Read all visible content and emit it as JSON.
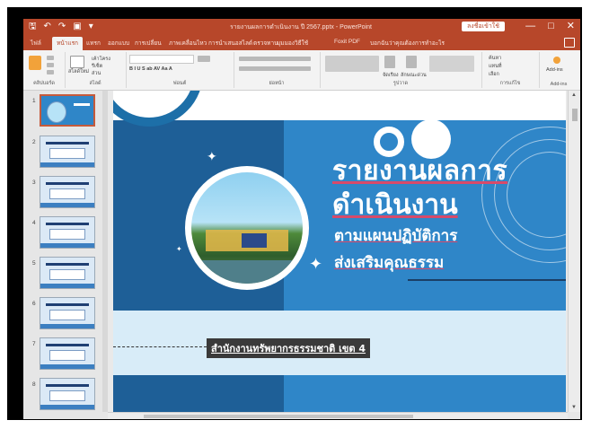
{
  "window": {
    "title": "รายงานผลการดำเนินงาน ปี 2567.pptx - PowerPoint",
    "signin": "ลงชื่อเข้าใช้",
    "minimize_glyph": "—",
    "maximize_glyph": "□",
    "close_glyph": "✕"
  },
  "qat": {
    "save": "🖫",
    "undo": "↶",
    "redo": "↷",
    "present": "▣",
    "more": "▾"
  },
  "tabs": [
    {
      "label": "ไฟล์"
    },
    {
      "label": "หน้าแรก"
    },
    {
      "label": "แทรก"
    },
    {
      "label": "ออกแบบ"
    },
    {
      "label": "การเปลี่ยน"
    },
    {
      "label": "ภาพเคลื่อนไหว"
    },
    {
      "label": "การนำเสนอสไลด์"
    },
    {
      "label": "ตรวจทาน"
    },
    {
      "label": "มุมมอง"
    },
    {
      "label": "วิธีใช้"
    },
    {
      "label": "Foxit PDF"
    },
    {
      "label": "บอกฉันว่าคุณต้องการทำอะไร"
    }
  ],
  "ribbon": {
    "groups": [
      "คลิปบอร์ด",
      "สไลด์",
      "ฟอนต์",
      "ย่อหน้า",
      "รูปวาด",
      "การแก้ไข",
      "Add-ins"
    ],
    "new_slide": "สไลด์ใหม่",
    "layout": "เค้าโครง",
    "reset": "รีเซ็ต",
    "section": "ส่วน",
    "arrange": "จัดเรียง",
    "quick_styles": "ลักษณะด่วน",
    "find": "ค้นหา",
    "replace": "แทนที่",
    "select": "เลือก",
    "addins": "Add-ins"
  },
  "slides": {
    "numbers": [
      "1",
      "2",
      "3",
      "4",
      "5",
      "6",
      "7",
      "8"
    ],
    "selected": 1
  },
  "slide": {
    "title_line1": "รายงานผลการ",
    "title_line2": "ดำเนินงาน",
    "subtitle_line1": "ตามแผนปฏิบัติการ",
    "subtitle_line2": "ส่งเสริมคุณธรรม",
    "org": "สำนักงานทรัพยากรธรรมชาติ เขต 4",
    "colors": {
      "dark_blue": "#1e5f97",
      "blue": "#2f86c8",
      "light_blue": "#d8ecf8",
      "accent": "#b7472a"
    }
  }
}
